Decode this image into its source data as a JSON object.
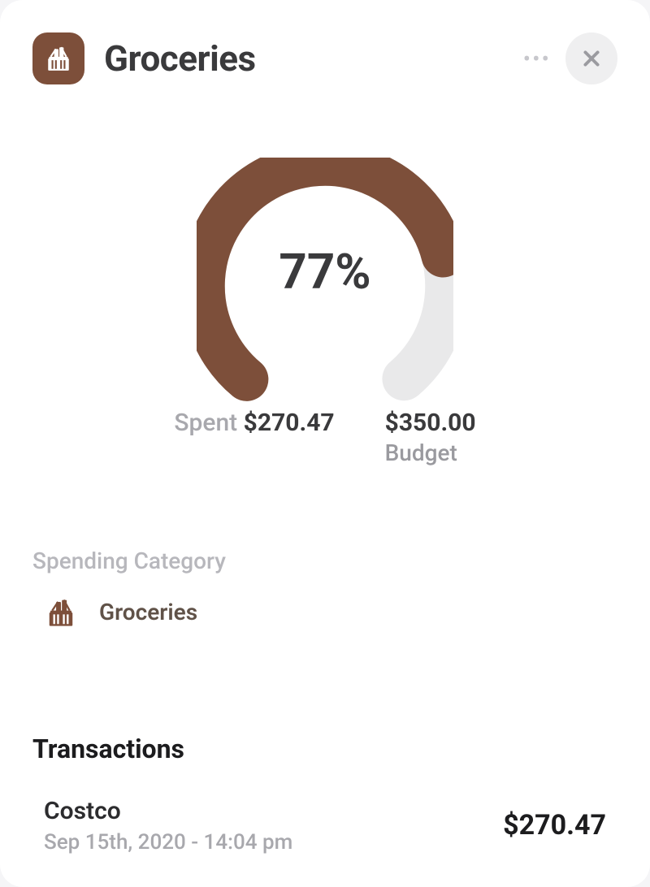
{
  "header": {
    "title": "Groceries",
    "icon": "groceries-basket",
    "accent": "#7d4f3a"
  },
  "chart_data": {
    "type": "gauge",
    "percent": 77,
    "display": "77%",
    "spent": 270.47,
    "budget": 350.0,
    "colors": {
      "track": "#e9e9ea",
      "progress": "#7d4f3a"
    }
  },
  "stats": {
    "spent_label": "Spent",
    "spent_value": "$270.47",
    "budget_value": "$350.00",
    "budget_label": "Budget"
  },
  "category_section": {
    "label": "Spending Category",
    "items": [
      {
        "name": "Groceries",
        "icon": "groceries-basket"
      }
    ]
  },
  "transactions": {
    "heading": "Transactions",
    "items": [
      {
        "name": "Costco",
        "date": "Sep 15th, 2020 - 14:04 pm",
        "amount": "$270.47"
      }
    ]
  }
}
